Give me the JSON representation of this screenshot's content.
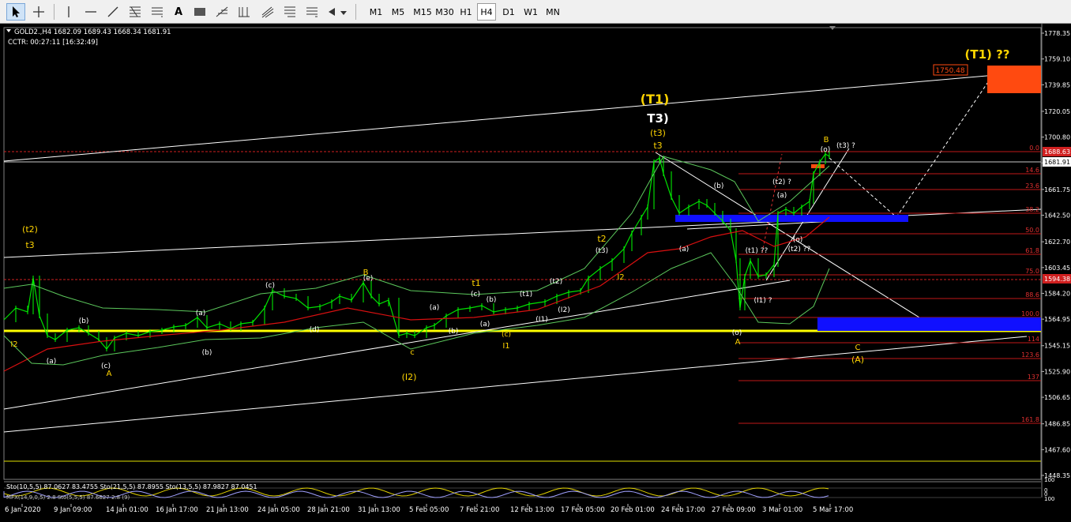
{
  "toolbar": {
    "tools": [
      {
        "name": "cursor-tool-button",
        "icon": "cursor-arrow-icon"
      },
      {
        "name": "crosshair-tool-button",
        "icon": "crosshair-icon"
      },
      {
        "name": "vertical-line-button",
        "icon": "vertical-line-icon"
      },
      {
        "name": "horizontal-line-button",
        "icon": "horizontal-line-icon"
      },
      {
        "name": "trendline-button",
        "icon": "trendline-icon"
      },
      {
        "name": "fibonacci-fan-button",
        "icon": "fibonacci-fan-icon"
      },
      {
        "name": "fibonacci-retracement-button",
        "icon": "fibonacci-retracement-icon"
      },
      {
        "name": "text-tool-button",
        "icon": "text-icon",
        "label": "A"
      },
      {
        "name": "text-label-button",
        "icon": "label-rectangle-icon"
      },
      {
        "name": "andrews-pitchfork-button",
        "icon": "pitchfork-icon"
      },
      {
        "name": "fibonacci-timezones-button",
        "icon": "fibonacci-timezones-icon"
      },
      {
        "name": "fibonacci-channel-button",
        "icon": "fibonacci-channel-icon"
      },
      {
        "name": "cycle-lines-button",
        "icon": "cycle-lines-icon"
      },
      {
        "name": "arrows-dropdown-button",
        "icon": "arrows-icon"
      }
    ],
    "timeframes": [
      "M1",
      "M5",
      "M15",
      "M30",
      "H1",
      "H4",
      "D1",
      "W1",
      "MN"
    ],
    "active_timeframe": "H4"
  },
  "chart": {
    "symbol_line": "GOLD2.,H4  1682.09 1689.43 1668.34 1681.91",
    "countdown_line": "CCTR: 00:27:11 [16:32:49]",
    "price_axis": [
      "1778.35",
      "1759.10",
      "1739.85",
      "1720.05",
      "1700.80",
      "1681.55",
      "1661.75",
      "1642.50",
      "1622.70",
      "1603.45",
      "1584.20",
      "1564.95",
      "1545.15",
      "1525.90",
      "1506.65",
      "1486.85",
      "1467.60",
      "1448.35"
    ],
    "price_range": [
      1440,
      1782
    ],
    "current_price_label": "1681.91",
    "current_price": 1681.91,
    "high_level_label": "1688.63",
    "low_level_label": "1594.38",
    "sub_axis": [
      "100",
      "0",
      "0",
      "100"
    ],
    "time_axis": [
      "6 Jan 2020",
      "9 Jan 09:00",
      "14 Jan 01:00",
      "16 Jan 17:00",
      "21 Jan 13:00",
      "24 Jan 05:00",
      "28 Jan 21:00",
      "31 Jan 13:00",
      "5 Feb 05:00",
      "7 Feb 21:00",
      "12 Feb 13:00",
      "17 Feb 05:00",
      "20 Feb 01:00",
      "24 Feb 17:00",
      "27 Feb 09:00",
      "3 Mar 01:00",
      "5 Mar 17:00"
    ],
    "target_box_label": "1750.48",
    "target_title": "(T1) ??",
    "fib_levels": [
      "0.0",
      "14.6",
      "23.6",
      "38.2",
      "50.0",
      "61.8",
      "75.0",
      "88.6",
      "100.0",
      "114",
      "123.6",
      "137",
      "161.8"
    ],
    "indicator_line_1": "Sto(10,5,5) 87.0627 83.4755  Sto(21,5,5) 87.8955  Sto(13,5,5) 87.9827 87.0451",
    "indicator_line_2": "MFX(14,9,0,5) 2.8  Sto(5,5,5)  87.6627 2.8 (9)",
    "wave_labels": {
      "T1": "(T1)",
      "T3": "T3)",
      "t3_paren": "(t3)",
      "t3": "t3",
      "t2_paren": "(t2)",
      "t3_left": "t3",
      "I2_left": "I2",
      "a1": "(a)",
      "b1": "(b)",
      "c1": "(c)",
      "A1": "A",
      "a2": "(a)",
      "b2": "(b)",
      "c_mid": "(c)",
      "d1": "(d)",
      "e1": "(e)",
      "B1": "B",
      "c_small": "c",
      "I2_paren": "(I2)",
      "a3": "(a)",
      "b3": "(b)",
      "c3": "(c)",
      "t1": "t1",
      "a4": "(a)",
      "c4": "(c)",
      "I1": "I1",
      "t1_paren": "(t1)",
      "I1_paren": "(I1)",
      "t2_paren2": "(t2)",
      "I2_paren2": "(I2)",
      "t2": "t2",
      "t3_paren2": "(t3)",
      "I2": "I2",
      "b_top": "(b)",
      "a_low": "(a)",
      "o_low": "(o)",
      "A2": "A",
      "t1q": "(t1) ??",
      "I1q": "(I1) ?",
      "t2q": "(t2) ?",
      "a5": "(a)",
      "o2": "(o)",
      "t2q2": "(t2) ??",
      "B2": "B",
      "o3": "(o)",
      "t3q": "(t3) ?",
      "C": "C",
      "A_paren": "(A)"
    }
  }
}
